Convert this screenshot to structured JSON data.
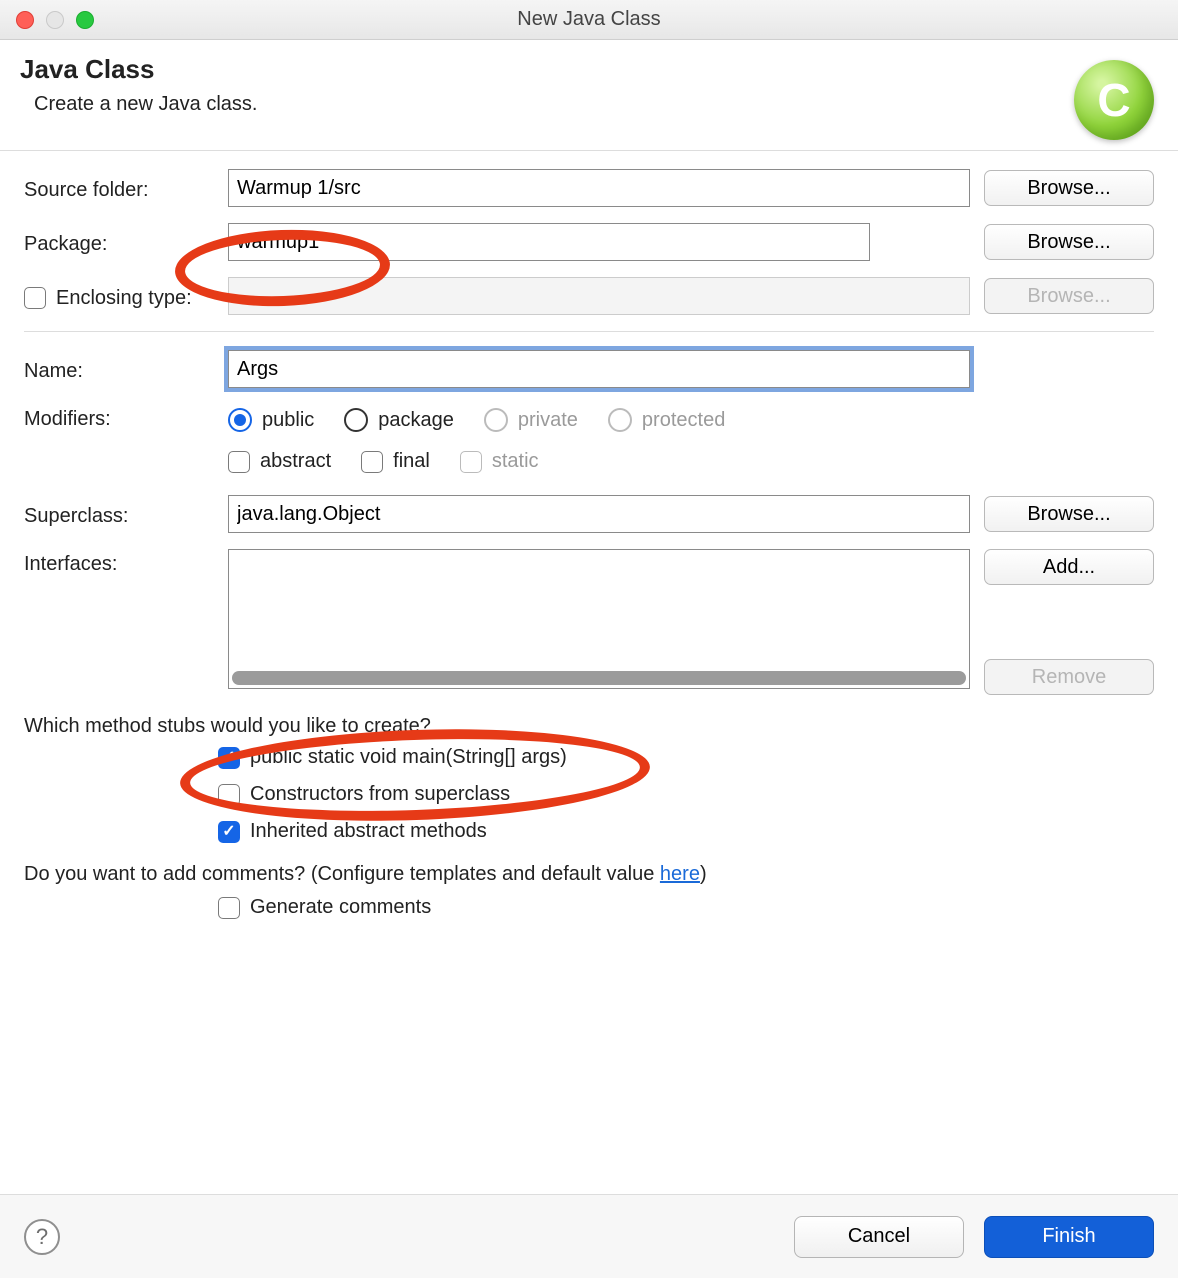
{
  "window": {
    "title": "New Java Class"
  },
  "header": {
    "title": "Java Class",
    "description": "Create a new Java class."
  },
  "fields": {
    "source_folder_label": "Source folder:",
    "source_folder_value": "Warmup 1/src",
    "package_label": "Package:",
    "package_value": "warmup1",
    "enclosing_label": "Enclosing type:",
    "enclosing_value": "",
    "name_label": "Name:",
    "name_value": "Args",
    "modifiers_label": "Modifiers:",
    "superclass_label": "Superclass:",
    "superclass_value": "java.lang.Object",
    "interfaces_label": "Interfaces:"
  },
  "buttons": {
    "browse": "Browse...",
    "add": "Add...",
    "remove": "Remove",
    "cancel": "Cancel",
    "finish": "Finish"
  },
  "modifiers": {
    "access": {
      "public": "public",
      "package": "package",
      "private": "private",
      "protected": "protected"
    },
    "flags": {
      "abstract": "abstract",
      "final": "final",
      "static": "static"
    }
  },
  "stubs": {
    "question": "Which method stubs would you like to create?",
    "main": "public static void main(String[] args)",
    "constructors": "Constructors from superclass",
    "inherited": "Inherited abstract methods"
  },
  "comments": {
    "question_prefix": "Do you want to add comments? (Configure templates and default value ",
    "link": "here",
    "question_suffix": ")",
    "generate": "Generate comments"
  }
}
